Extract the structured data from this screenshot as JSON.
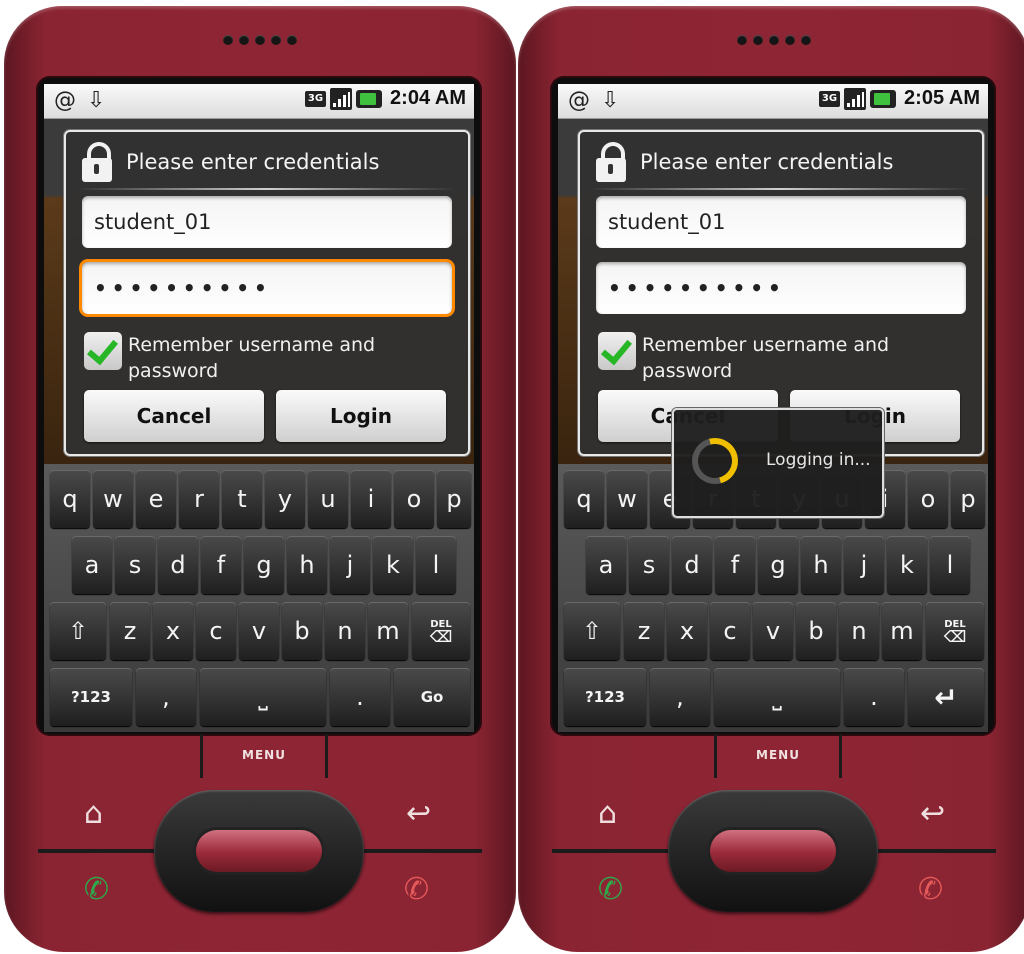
{
  "screens": [
    {
      "status_bar": {
        "left_icons": [
          "@",
          "⇩"
        ],
        "network": "3G",
        "time": "2:04 AM"
      },
      "dialog": {
        "title": "Please enter credentials",
        "username_value": "student_01",
        "password_mask": "••••••••••",
        "password_focused": true,
        "remember_label": "Remember username and password",
        "remember_checked": true,
        "cancel_label": "Cancel",
        "login_label": "Login"
      },
      "keyboard": {
        "row1": [
          "q",
          "w",
          "e",
          "r",
          "t",
          "y",
          "u",
          "i",
          "o",
          "p"
        ],
        "row2": [
          "a",
          "s",
          "d",
          "f",
          "g",
          "h",
          "j",
          "k",
          "l"
        ],
        "row3": [
          "⇧",
          "z",
          "x",
          "c",
          "v",
          "b",
          "n",
          "m"
        ],
        "del_label": "DEL",
        "symbols_label": "?123",
        "comma": ",",
        "period": ".",
        "action_label": "Go"
      },
      "hardware": {
        "menu_label": "MENU"
      }
    },
    {
      "status_bar": {
        "left_icons": [
          "@",
          "⇩"
        ],
        "network": "3G",
        "time": "2:05 AM"
      },
      "dialog": {
        "title": "Please enter credentials",
        "username_value": "student_01",
        "password_mask": "••••••••••",
        "password_focused": false,
        "remember_label": "Remember username and password",
        "remember_checked": true,
        "cancel_label": "Cancel",
        "login_label": "Login"
      },
      "progress": {
        "text": "Logging in..."
      },
      "keyboard": {
        "row1": [
          "q",
          "w",
          "e",
          "r",
          "t",
          "y",
          "u",
          "i",
          "o",
          "p"
        ],
        "row2": [
          "a",
          "s",
          "d",
          "f",
          "g",
          "h",
          "j",
          "k",
          "l"
        ],
        "row3": [
          "⇧",
          "z",
          "x",
          "c",
          "v",
          "b",
          "n",
          "m"
        ],
        "del_label": "DEL",
        "symbols_label": "?123",
        "comma": ",",
        "period": ".",
        "action_label": "↵"
      },
      "hardware": {
        "menu_label": "MENU"
      }
    }
  ],
  "colors": {
    "focus": "#ff8a00",
    "check": "#26b626",
    "spinner": "#f0c000",
    "phone": "#8e2535"
  }
}
